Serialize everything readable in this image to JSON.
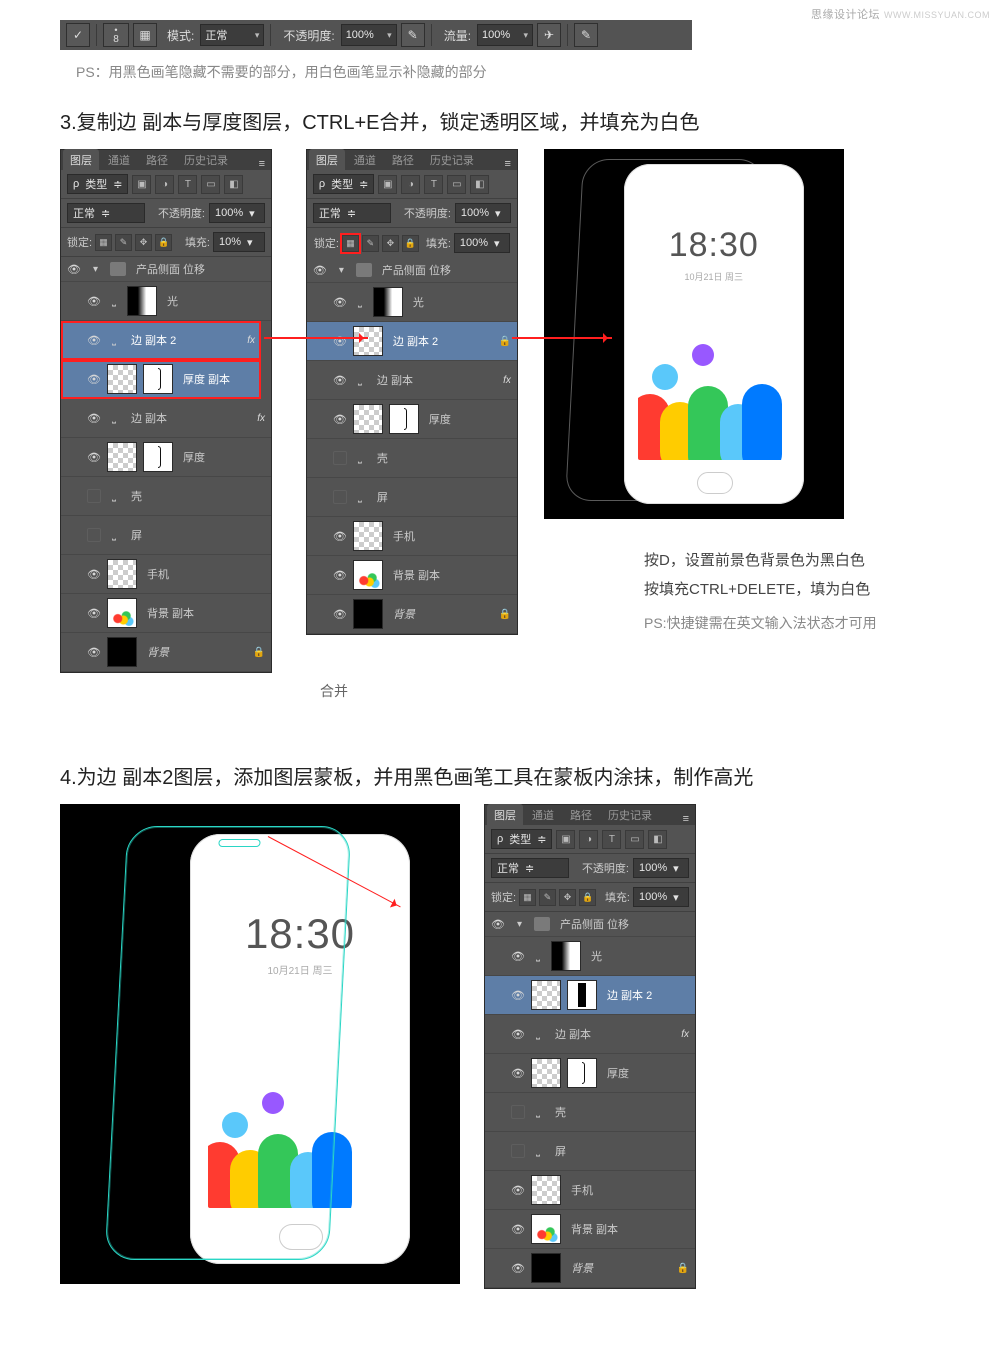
{
  "watermark": {
    "text": "思缘设计论坛",
    "url": "WWW.MISSYUAN.COM"
  },
  "brushbar": {
    "size_value": "8",
    "mode_label": "模式:",
    "mode_value": "正常",
    "opacity_label": "不透明度:",
    "opacity_value": "100%",
    "flow_label": "流量:",
    "flow_value": "100%"
  },
  "ps_note_top": "PS：用黑色画笔隐藏不需要的部分，用白色画笔显示补隐藏的部分",
  "step3_title": "3.复制边 副本与厚度图层，CTRL+E合并，锁定透明区域，并填充为白色",
  "panel_common": {
    "tabs": {
      "layers": "图层",
      "channels": "通道",
      "paths": "路径",
      "history": "历史记录"
    },
    "kind_label": "类型",
    "blend_mode": "正常",
    "opacity_label": "不透明度:",
    "lock_label": "锁定:",
    "fill_label": "填充:",
    "group_name": "产品侧面 位移"
  },
  "panelA": {
    "opacity_value": "100%",
    "fill_value": "10%",
    "layers": [
      {
        "name": "光"
      },
      {
        "name": "边 副本 2",
        "fx": "fx"
      },
      {
        "name": "厚度  副本"
      },
      {
        "name": "边 副本",
        "fx": "fx"
      },
      {
        "name": "厚度"
      },
      {
        "name": "壳"
      },
      {
        "name": "屏"
      },
      {
        "name": "手机"
      },
      {
        "name": "背景 副本"
      },
      {
        "name": "背景",
        "locked": true,
        "italic": true
      }
    ]
  },
  "panelB": {
    "opacity_value": "100%",
    "fill_value": "100%",
    "layers": [
      {
        "name": "光"
      },
      {
        "name": "边 副本 2",
        "locked": true
      },
      {
        "name": "边 副本",
        "fx": "fx"
      },
      {
        "name": "厚度"
      },
      {
        "name": "壳"
      },
      {
        "name": "屏"
      },
      {
        "name": "手机"
      },
      {
        "name": "背景 副本"
      },
      {
        "name": "背景",
        "locked": true,
        "italic": true
      }
    ],
    "caption": "合并"
  },
  "sidecap3": {
    "line1": "按D，设置前景色背景色为黑白色",
    "line2": "按填充CTRL+DELETE，填为白色",
    "ps": "PS:快捷键需在英文输入法状态才可用"
  },
  "phone_preview": {
    "time": "18:30",
    "date": "10月21日 周三"
  },
  "step4_title": "4.为边 副本2图层，添加图层蒙板，并用黑色画笔工具在蒙板内涂抹，制作高光",
  "panelC": {
    "opacity_value": "100%",
    "fill_value": "100%",
    "layers": [
      {
        "name": "光"
      },
      {
        "name": "边 副本 2"
      },
      {
        "name": "边 副本",
        "fx": "fx"
      },
      {
        "name": "厚度"
      },
      {
        "name": "壳"
      },
      {
        "name": "屏"
      },
      {
        "name": "手机"
      },
      {
        "name": "背景 副本"
      },
      {
        "name": "背景",
        "locked": true,
        "italic": true
      }
    ]
  }
}
